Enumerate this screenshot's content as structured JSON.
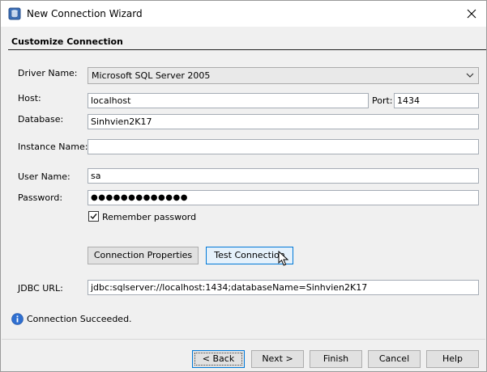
{
  "window": {
    "title": "New Connection Wizard"
  },
  "section": {
    "title": "Customize Connection"
  },
  "form": {
    "driver_label": "Driver Name:",
    "driver_value": "Microsoft SQL Server 2005",
    "host_label": "Host:",
    "host_value": "localhost",
    "port_label": "Port:",
    "port_value": "1434",
    "database_label": "Database:",
    "database_value": "Sinhvien2K17",
    "instance_label": "Instance Name:",
    "instance_value": "",
    "username_label": "User Name:",
    "username_value": "sa",
    "password_label": "Password:",
    "password_value": "●●●●●●●●●●●●●",
    "remember_label": "Remember password",
    "remember_checked": true,
    "jdbc_label": "JDBC URL:",
    "jdbc_value": "jdbc:sqlserver://localhost:1434;databaseName=Sinhvien2K17"
  },
  "actions": {
    "connection_properties": "Connection Properties",
    "test_connection": "Test Connection"
  },
  "status": {
    "message": "Connection Succeeded."
  },
  "footer": {
    "back": "< Back",
    "next": "Next >",
    "finish": "Finish",
    "cancel": "Cancel",
    "help": "Help"
  },
  "colors": {
    "accent": "#0078d7",
    "info": "#2f6fd0",
    "panel_bg": "#f0f0f0",
    "button_bg": "#e1e1e1"
  },
  "icons": {
    "app": "database-icon",
    "close": "close-icon",
    "dropdown": "chevron-down-icon",
    "status": "info-icon",
    "checkbox": "checkmark-icon",
    "cursor": "mouse-pointer-icon"
  }
}
